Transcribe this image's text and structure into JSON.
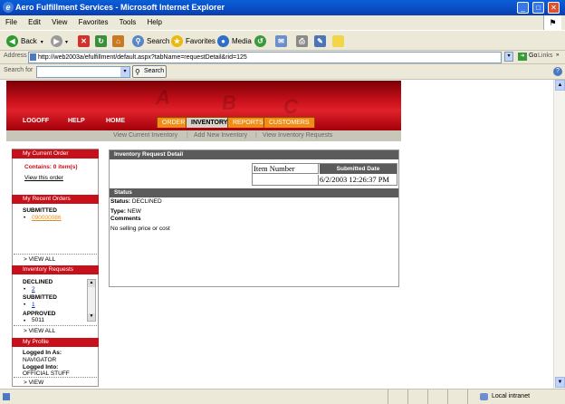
{
  "window": {
    "title": "Aero Fulfillment Services - Microsoft Internet Explorer",
    "min": "_",
    "max": "□",
    "close": "✕"
  },
  "menu": [
    "File",
    "Edit",
    "View",
    "Favorites",
    "Tools",
    "Help"
  ],
  "toolbar": {
    "back": "Back",
    "search": "Search",
    "favorites": "Favorites",
    "media": "Media"
  },
  "address": {
    "label": "Address",
    "url": "http://web2003a/efulfillment/default.aspx?tabName=requestDetail&rid=125",
    "go": "Go",
    "links": "Links"
  },
  "searchbar": {
    "label": "Search for",
    "button": "Search"
  },
  "nav": {
    "logoff": "LOGOFF",
    "help": "HELP",
    "home": "HOME"
  },
  "tabs": [
    "ORDER",
    "INVENTORY",
    "REPORTS",
    "CUSTOMERS"
  ],
  "banner_letters": [
    "A",
    "B",
    "C"
  ],
  "subnav": [
    "View Current Inventory",
    "Add New Inventory",
    "View Inventory Requests"
  ],
  "sidebar": {
    "current_order": {
      "title": "My Current Order",
      "contains": "Contains: 0 item(s)",
      "view": "View this order"
    },
    "recent_orders": {
      "title": "My Recent Orders",
      "status": "SUBMITTED",
      "order": "090000086",
      "view_all": "> VIEW ALL"
    },
    "inventory_requests": {
      "title": "Inventory Requests",
      "declined": "DECLINED",
      "declined_id": "2",
      "submitted": "SUBMITTED",
      "submitted_id": "1",
      "approved": "APPROVED",
      "approved_id": "5011",
      "view_all": "> VIEW ALL"
    },
    "profile": {
      "title": "My Profile",
      "logged_in_as_label": "Logged In As:",
      "logged_in_as": "NAVIGATOR",
      "logged_into_label": "Logged Into:",
      "logged_into": "OFFICIAL STUFF",
      "view": "> VIEW"
    }
  },
  "panel": {
    "title": "Inventory Request Detail",
    "item_number_header": "Item Number",
    "submitted_date_header": "Submitted Date",
    "submitted_date": "6/2/2003 12:26:37 PM",
    "status_title": "Status",
    "status_label": "Status:",
    "status_value": "DECLINED",
    "type_label": "Type:",
    "type_value": "NEW",
    "comments_label": "Comments",
    "comment": "No selling price or cost"
  },
  "statusbar": {
    "zone": "Local intranet"
  },
  "colors": {
    "brand_red": "#c8101a",
    "tab_orange": "#f08d14",
    "xp_blue": "#0b4fc8"
  }
}
